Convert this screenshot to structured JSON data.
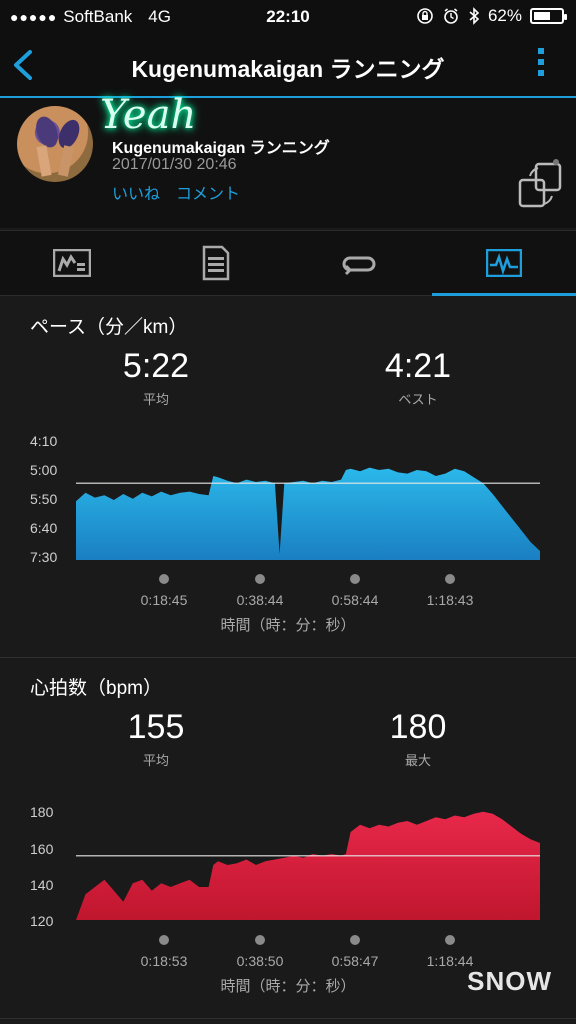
{
  "status_bar": {
    "signal": "●●●●●",
    "carrier": "SoftBank",
    "network": "4G",
    "time": "22:10",
    "battery_percent": "62%",
    "battery_level": 0.62
  },
  "nav": {
    "title": "Kugenumakaigan ランニング"
  },
  "activity": {
    "sticker_text": "Yeah",
    "name": "Kugenumakaigan ランニング",
    "datetime": "2017/01/30 20:46",
    "like_label": "いいね",
    "comment_label": "コメント"
  },
  "pace": {
    "title": "ペース（分／km）",
    "avg_value": "5:22",
    "avg_label": "平均",
    "best_value": "4:21",
    "best_label": "ベスト",
    "y_ticks": [
      "4:10",
      "5:00",
      "5:50",
      "6:40",
      "7:30"
    ],
    "x_ticks": [
      "0:18:45",
      "0:38:44",
      "0:58:44",
      "1:18:43"
    ],
    "axis_title": "時間（時：分：秒）"
  },
  "hr": {
    "title": "心拍数（bpm）",
    "avg_value": "155",
    "avg_label": "平均",
    "max_value": "180",
    "max_label": "最大",
    "y_ticks": [
      "180",
      "160",
      "140",
      "120"
    ],
    "x_ticks": [
      "0:18:53",
      "0:38:50",
      "0:58:47",
      "1:18:44"
    ],
    "axis_title": "時間（時：分：秒）"
  },
  "watermark": "SNOW",
  "colors": {
    "accent": "#1e9fdc",
    "pace_fill": "#1ea8dc",
    "hr_fill": "#d8203c"
  },
  "chart_data": [
    {
      "type": "area",
      "title": "ペース（分／km）",
      "xlabel": "時間（時：分：秒）",
      "ylabel": "",
      "y_unit": "min/km",
      "y_inverted": true,
      "ylim_seconds": [
        250,
        450
      ],
      "x_ticks": [
        "0:18:45",
        "0:38:44",
        "0:58:44",
        "1:18:43"
      ],
      "average_line_seconds": 322,
      "x_minutes": [
        0,
        2,
        4,
        6,
        8,
        10,
        12,
        14,
        16,
        18,
        20,
        22,
        24,
        26,
        28,
        29,
        30,
        32,
        34,
        36,
        38,
        40,
        42,
        43,
        44,
        46,
        48,
        50,
        52,
        54,
        56,
        57,
        58,
        60,
        62,
        64,
        66,
        68,
        70,
        72,
        74,
        76,
        78,
        80,
        82,
        84,
        86,
        88,
        90,
        92,
        94,
        96,
        98
      ],
      "pace_seconds": [
        352,
        338,
        346,
        342,
        350,
        340,
        348,
        338,
        344,
        336,
        342,
        338,
        336,
        340,
        342,
        310,
        312,
        318,
        322,
        316,
        320,
        318,
        322,
        440,
        322,
        320,
        318,
        322,
        318,
        320,
        316,
        300,
        298,
        302,
        296,
        300,
        298,
        304,
        306,
        300,
        302,
        310,
        306,
        298,
        302,
        312,
        322,
        340,
        360,
        380,
        400,
        420,
        435
      ]
    },
    {
      "type": "area",
      "title": "心拍数（bpm）",
      "xlabel": "時間（時：分：秒）",
      "ylabel": "",
      "ylim": [
        120,
        180
      ],
      "x_ticks": [
        "0:18:53",
        "0:38:50",
        "0:58:47",
        "1:18:44"
      ],
      "average_line": 155,
      "x_minutes": [
        0,
        2,
        4,
        6,
        8,
        10,
        12,
        14,
        16,
        18,
        20,
        22,
        24,
        26,
        28,
        29,
        30,
        32,
        34,
        36,
        38,
        40,
        42,
        44,
        46,
        48,
        50,
        52,
        54,
        56,
        57,
        58,
        60,
        62,
        64,
        66,
        68,
        70,
        72,
        74,
        76,
        78,
        80,
        82,
        84,
        86,
        88,
        90,
        92,
        94,
        96,
        98
      ],
      "bpm": [
        120,
        134,
        138,
        142,
        136,
        130,
        140,
        142,
        136,
        140,
        138,
        140,
        142,
        138,
        138,
        150,
        152,
        150,
        151,
        153,
        150,
        152,
        153,
        154,
        155,
        154,
        156,
        155,
        156,
        155,
        156,
        168,
        172,
        170,
        172,
        171,
        173,
        174,
        172,
        174,
        176,
        175,
        177,
        176,
        178,
        179,
        178,
        175,
        171,
        167,
        164,
        162
      ]
    }
  ]
}
